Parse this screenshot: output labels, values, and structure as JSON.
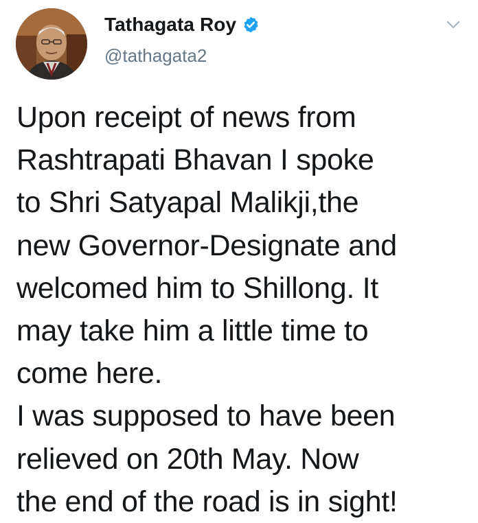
{
  "author": {
    "display_name": "Tathagata Roy",
    "handle": "@tathagata2",
    "verified": true,
    "avatar_icon": "profile-photo"
  },
  "icons": {
    "verified": "verified-badge-icon",
    "menu": "chevron-down-icon"
  },
  "colors": {
    "text": "#14171a",
    "secondary": "#657786",
    "verified": "#1da1f2"
  },
  "tweet": {
    "text": "Upon receipt of news from\nRashtrapati Bhavan I spoke\nto Shri Satyapal Malikji,the\nnew Governor-Designate and\nwelcomed him to Shillong. It\nmay take him a little time to\ncome here.\nI was supposed to have been\nrelieved on 20th May. Now\nthe end of the road is in sight!"
  }
}
